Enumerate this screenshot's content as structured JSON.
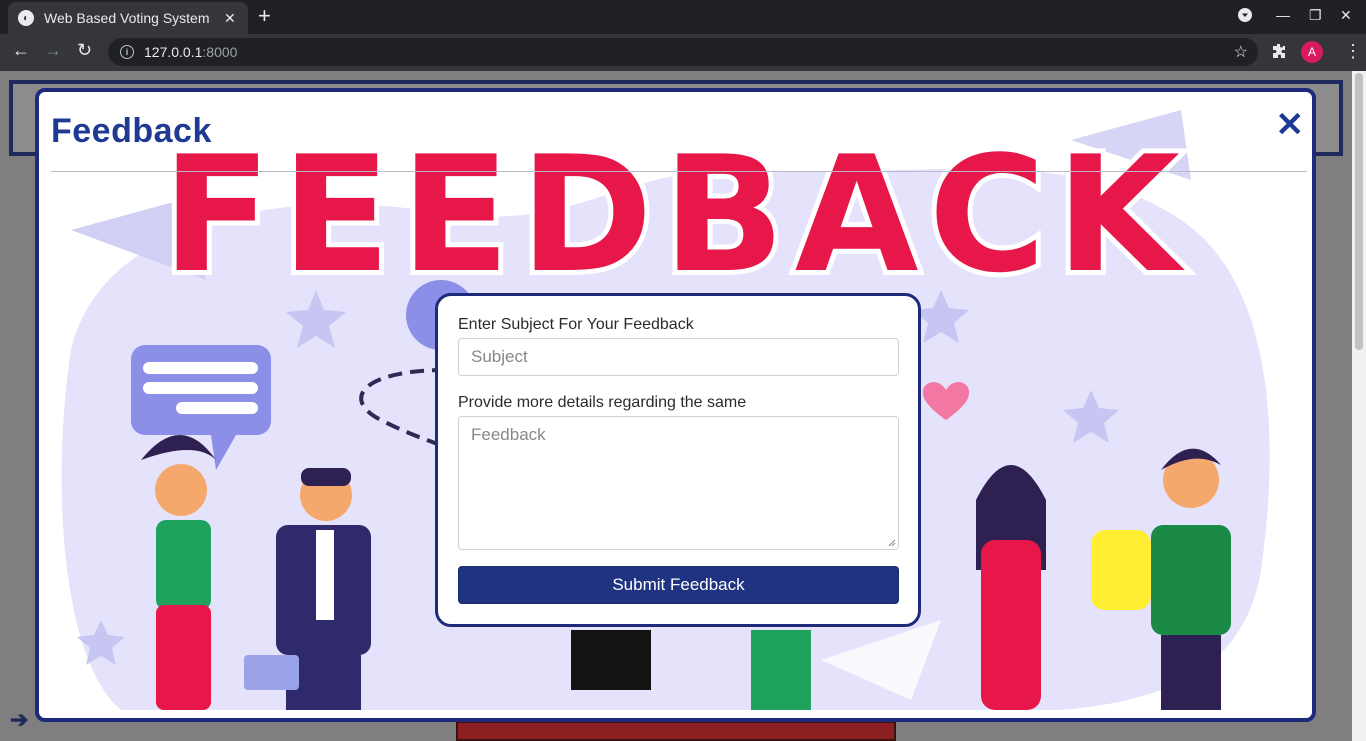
{
  "browser": {
    "tab_title": "Web Based Voting System",
    "url_host": "127.0.0.1",
    "url_port": ":8000",
    "profile_initial": "A"
  },
  "modal": {
    "title": "Feedback",
    "banner_text": "FEEDBACK",
    "close_icon": "close-icon"
  },
  "form": {
    "subject_label": "Enter Subject For Your Feedback",
    "subject_placeholder": "Subject",
    "details_label": "Provide more details regarding the same",
    "details_placeholder": "Feedback",
    "submit_label": "Submit Feedback"
  },
  "colors": {
    "accent": "#1f3380",
    "banner_red": "#e8174a",
    "banner_bg": "#e4e3fb"
  }
}
